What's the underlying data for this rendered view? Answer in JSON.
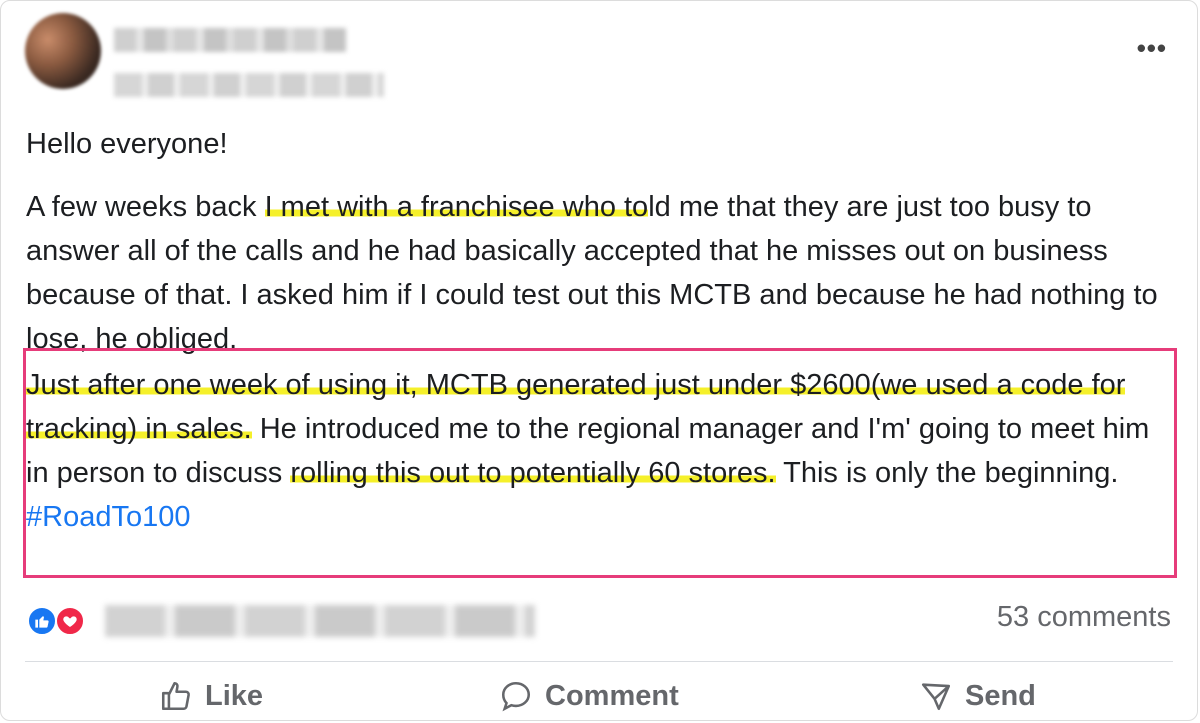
{
  "header": {
    "author_name": "",
    "meta": "",
    "more_label": "•••"
  },
  "body": {
    "greeting": "Hello everyone!",
    "para1": {
      "part1": "A few weeks back ",
      "highlight1": "I met with a franchisee who to",
      "part2": "ld me that they are just too busy to answer all of the calls and he had basically accepted that he misses out on business because of that.  I asked him if I could test out this MCTB and because he had nothing to lose, he obliged."
    },
    "para2": {
      "highlight1": "Just after one week of using it, MCTB generated just under $2600(we used a code for tracking) in sales.",
      "part1": "  He introduced me to the regional manager and I'm' going to meet him in person to discuss ",
      "highlight2": "rolling this out to potentially 60 stores.",
      "part2": " This is only the beginning.",
      "hashtag": "#RoadTo100"
    }
  },
  "footer": {
    "comments": "53 comments",
    "actions": {
      "like": "Like",
      "comment": "Comment",
      "send": "Send"
    }
  },
  "colors": {
    "highlight": "#f5f02a",
    "annotation_border": "#e63c7a",
    "link": "#1877f2",
    "muted": "#65676b"
  }
}
